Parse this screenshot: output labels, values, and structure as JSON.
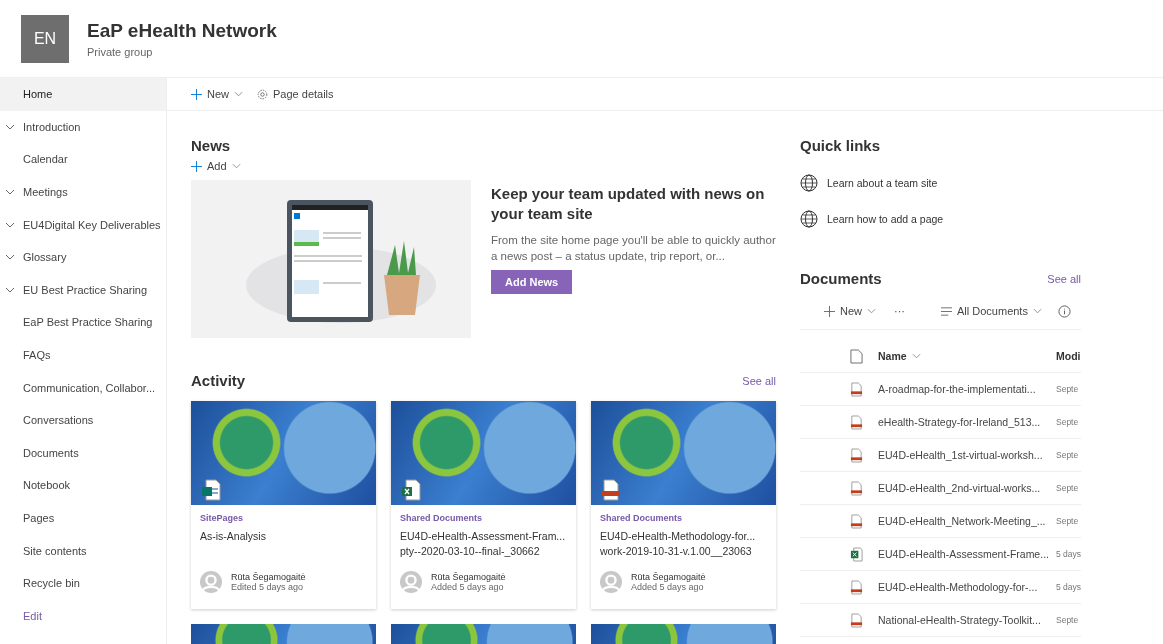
{
  "site": {
    "initials": "EN",
    "title": "EaP eHealth Network",
    "subtitle": "Private group"
  },
  "sidebar": {
    "items": [
      {
        "label": "Home",
        "expandable": false,
        "selected": true
      },
      {
        "label": "Introduction",
        "expandable": true,
        "selected": false
      },
      {
        "label": "Calendar",
        "expandable": false,
        "selected": false
      },
      {
        "label": "Meetings",
        "expandable": true,
        "selected": false
      },
      {
        "label": "EU4Digital Key Deliverables",
        "expandable": true,
        "selected": false
      },
      {
        "label": "Glossary",
        "expandable": true,
        "selected": false
      },
      {
        "label": "EU Best Practice Sharing",
        "expandable": true,
        "selected": false
      },
      {
        "label": "EaP Best Practice Sharing",
        "expandable": false,
        "selected": false
      },
      {
        "label": "FAQs",
        "expandable": false,
        "selected": false
      },
      {
        "label": "Communication, Collabor...",
        "expandable": false,
        "selected": false
      },
      {
        "label": "Conversations",
        "expandable": false,
        "selected": false
      },
      {
        "label": "Documents",
        "expandable": false,
        "selected": false
      },
      {
        "label": "Notebook",
        "expandable": false,
        "selected": false
      },
      {
        "label": "Pages",
        "expandable": false,
        "selected": false
      },
      {
        "label": "Site contents",
        "expandable": false,
        "selected": false
      },
      {
        "label": "Recycle bin",
        "expandable": false,
        "selected": false
      }
    ],
    "edit_link": "Edit"
  },
  "toolbar": {
    "new": "New",
    "page_details": "Page details"
  },
  "news": {
    "title": "News",
    "add": "Add",
    "headline": "Keep your team updated with news on your team site",
    "body": "From the site home page you'll be able to quickly author a news post – a status update, trip report, or...",
    "button": "Add News"
  },
  "activity": {
    "title": "Activity",
    "see_all": "See all",
    "cards": [
      {
        "kind": "page",
        "source": "SitePages",
        "title_lines": [
          "As-is-Analysis"
        ],
        "author": "Rūta Šegamogaitė",
        "action": "Edited 5 days ago"
      },
      {
        "kind": "excel",
        "source": "Shared Documents",
        "title_lines": [
          "EU4D-eHealth-Assessment-Fram...",
          "pty--2020-03-10--final-_30662"
        ],
        "author": "Rūta Šegamogaitė",
        "action": "Added 5 days ago"
      },
      {
        "kind": "pdf",
        "source": "Shared Documents",
        "title_lines": [
          "EU4D-eHealth-Methodology-for...",
          "work-2019-10-31-v.1.00__23063"
        ],
        "author": "Rūta Šegamogaitė",
        "action": "Added 5 days ago"
      }
    ]
  },
  "quick_links": {
    "title": "Quick links",
    "links": [
      "Learn about a team site",
      "Learn how to add a page"
    ]
  },
  "documents": {
    "title": "Documents",
    "see_all": "See all",
    "new": "New",
    "more": "···",
    "view": "All Documents",
    "columns": [
      "Name",
      "Modi"
    ],
    "rows": [
      {
        "kind": "pdf",
        "name": "A-roadmap-for-the-implementati...",
        "modified": "Septe"
      },
      {
        "kind": "pdf",
        "name": "eHealth-Strategy-for-Ireland_513...",
        "modified": "Septe"
      },
      {
        "kind": "pdf",
        "name": "EU4D-eHealth_1st-virtual-worksh...",
        "modified": "Septe"
      },
      {
        "kind": "pdf",
        "name": "EU4D-eHealth_2nd-virtual-works...",
        "modified": "Septe"
      },
      {
        "kind": "pdf",
        "name": "EU4D-eHealth_Network-Meeting_...",
        "modified": "Septe"
      },
      {
        "kind": "excel",
        "name": "EU4D-eHealth-Assessment-Frame...",
        "modified": "5 days"
      },
      {
        "kind": "pdf",
        "name": "EU4D-eHealth-Methodology-for-...",
        "modified": "5 days"
      },
      {
        "kind": "pdf",
        "name": "National-eHealth-Strategy-Toolkit...",
        "modified": "Septe"
      }
    ]
  }
}
